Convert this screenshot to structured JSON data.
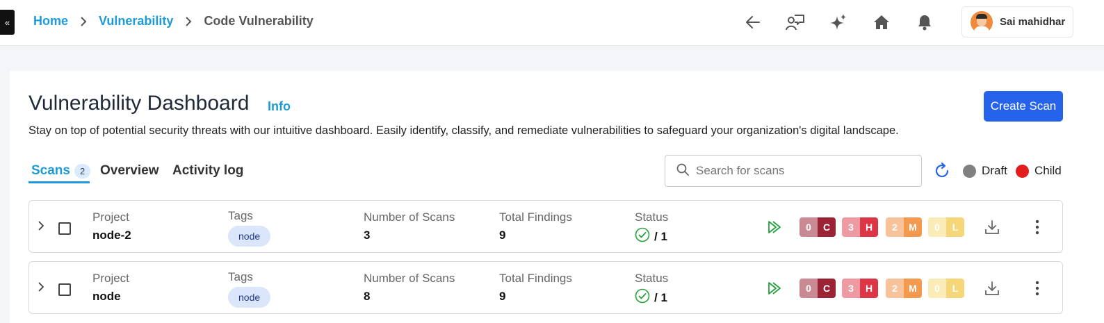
{
  "breadcrumb": {
    "home": "Home",
    "section": "Vulnerability",
    "current": "Code Vulnerability"
  },
  "user": {
    "name": "Sai mahidhar"
  },
  "page": {
    "title": "Vulnerability Dashboard",
    "info_link": "Info",
    "subtitle": "Stay on top of potential security threats with our intuitive dashboard. Easily identify, classify, and remediate vulnerabilities to safeguard your organization's digital landscape.",
    "create_button": "Create Scan"
  },
  "tabs": [
    {
      "label": "Scans",
      "count": "2",
      "active": true
    },
    {
      "label": "Overview"
    },
    {
      "label": "Activity log"
    }
  ],
  "search": {
    "placeholder": "Search for scans"
  },
  "legend": [
    {
      "label": "Draft",
      "color": "#808080"
    },
    {
      "label": "Child",
      "color": "#e11d1d"
    }
  ],
  "columns": {
    "project": "Project",
    "tags": "Tags",
    "scans": "Number of Scans",
    "findings": "Total Findings",
    "status": "Status"
  },
  "rows": [
    {
      "project": "node-2",
      "tag": "node",
      "scans": "3",
      "findings": "9",
      "status": "/ 1",
      "severity": {
        "critical": {
          "count": "0",
          "letter": "C"
        },
        "high": {
          "count": "3",
          "letter": "H"
        },
        "medium": {
          "count": "2",
          "letter": "M"
        },
        "low": {
          "count": "0",
          "letter": "L"
        }
      }
    },
    {
      "project": "node",
      "tag": "node",
      "scans": "8",
      "findings": "9",
      "status": "/ 1",
      "severity": {
        "critical": {
          "count": "0",
          "letter": "C"
        },
        "high": {
          "count": "3",
          "letter": "H"
        },
        "medium": {
          "count": "2",
          "letter": "M"
        },
        "low": {
          "count": "0",
          "letter": "L"
        }
      }
    }
  ],
  "colors": {
    "accent": "#1d9bd8",
    "primary_button": "#2563eb",
    "critical_dark": "#9b2335",
    "critical_light": "#c98a93",
    "high_dark": "#dc3545",
    "high_light": "#ee9aa3",
    "medium_dark": "#f39a4e",
    "medium_light": "#f8c29a",
    "low_dark": "#f5d77a",
    "low_light": "#faebb8",
    "success": "#22a33a"
  },
  "icons": [
    "collapse-sidebar-icon",
    "chevron-right-icon",
    "back-arrow-icon",
    "feedback-icon",
    "sparkle-ai-icon",
    "home-icon",
    "bell-icon",
    "search-icon",
    "refresh-icon",
    "expand-chevron-icon",
    "check-circle-icon",
    "run-scan-icon",
    "download-icon",
    "more-vertical-icon"
  ]
}
